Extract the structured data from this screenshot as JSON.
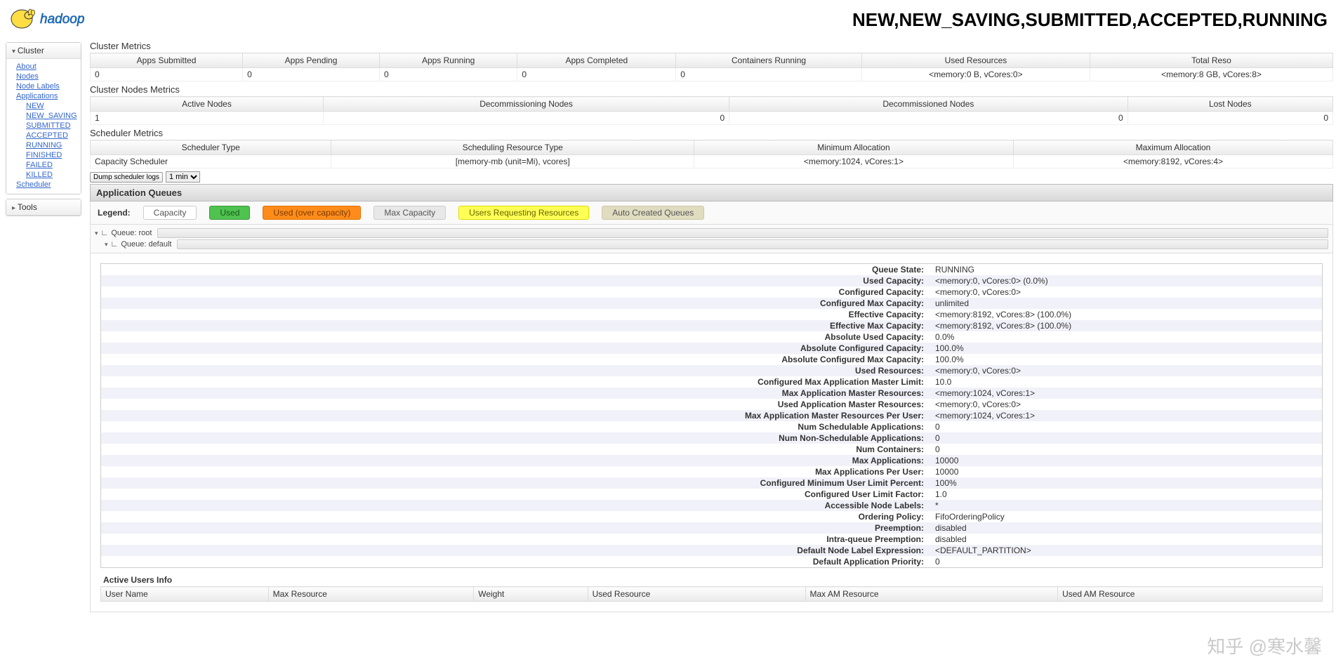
{
  "page_title": "NEW,NEW_SAVING,SUBMITTED,ACCEPTED,RUNNING",
  "sidebar": {
    "cluster": {
      "header": "Cluster",
      "links": {
        "about": "About",
        "nodes": "Nodes",
        "node_labels": "Node Labels",
        "applications": "Applications",
        "scheduler": "Scheduler"
      },
      "app_states": [
        "NEW",
        "NEW_SAVING",
        "SUBMITTED",
        "ACCEPTED",
        "RUNNING",
        "FINISHED",
        "FAILED",
        "KILLED"
      ]
    },
    "tools": {
      "header": "Tools"
    }
  },
  "cluster_metrics": {
    "title": "Cluster Metrics",
    "headers": [
      "Apps Submitted",
      "Apps Pending",
      "Apps Running",
      "Apps Completed",
      "Containers Running",
      "Used Resources",
      "Total Reso"
    ],
    "row": [
      "0",
      "0",
      "0",
      "0",
      "0",
      "<memory:0 B, vCores:0>",
      "<memory:8 GB, vCores:8>"
    ]
  },
  "nodes_metrics": {
    "title": "Cluster Nodes Metrics",
    "headers": [
      "Active Nodes",
      "Decommissioning Nodes",
      "Decommissioned Nodes",
      "Lost Nodes"
    ],
    "row": [
      "1",
      "0",
      "0",
      "0"
    ]
  },
  "scheduler_metrics": {
    "title": "Scheduler Metrics",
    "headers": [
      "Scheduler Type",
      "Scheduling Resource Type",
      "Minimum Allocation",
      "Maximum Allocation"
    ],
    "row": [
      "Capacity Scheduler",
      "[memory-mb (unit=Mi), vcores]",
      "<memory:1024, vCores:1>",
      "<memory:8192, vCores:4>"
    ]
  },
  "controls": {
    "dump_label": "Dump scheduler logs",
    "interval": "1 min"
  },
  "queues_panel": {
    "title": "Application Queues",
    "legend_label": "Legend:",
    "legend": {
      "capacity": "Capacity",
      "used": "Used",
      "used_over": "Used (over capacity)",
      "max": "Max Capacity",
      "requesting": "Users Requesting Resources",
      "auto": "Auto Created Queues"
    },
    "tree": {
      "root": "Queue: root",
      "default": "Queue: default"
    }
  },
  "queue_detail": [
    {
      "k": "Queue State:",
      "v": "RUNNING"
    },
    {
      "k": "Used Capacity:",
      "v": "<memory:0, vCores:0> (0.0%)"
    },
    {
      "k": "Configured Capacity:",
      "v": "<memory:0, vCores:0>"
    },
    {
      "k": "Configured Max Capacity:",
      "v": "unlimited"
    },
    {
      "k": "Effective Capacity:",
      "v": "<memory:8192, vCores:8> (100.0%)"
    },
    {
      "k": "Effective Max Capacity:",
      "v": "<memory:8192, vCores:8> (100.0%)"
    },
    {
      "k": "Absolute Used Capacity:",
      "v": "0.0%"
    },
    {
      "k": "Absolute Configured Capacity:",
      "v": "100.0%"
    },
    {
      "k": "Absolute Configured Max Capacity:",
      "v": "100.0%"
    },
    {
      "k": "Used Resources:",
      "v": "<memory:0, vCores:0>"
    },
    {
      "k": "Configured Max Application Master Limit:",
      "v": "10.0"
    },
    {
      "k": "Max Application Master Resources:",
      "v": "<memory:1024, vCores:1>"
    },
    {
      "k": "Used Application Master Resources:",
      "v": "<memory:0, vCores:0>"
    },
    {
      "k": "Max Application Master Resources Per User:",
      "v": "<memory:1024, vCores:1>"
    },
    {
      "k": "Num Schedulable Applications:",
      "v": "0"
    },
    {
      "k": "Num Non-Schedulable Applications:",
      "v": "0"
    },
    {
      "k": "Num Containers:",
      "v": "0"
    },
    {
      "k": "Max Applications:",
      "v": "10000"
    },
    {
      "k": "Max Applications Per User:",
      "v": "10000"
    },
    {
      "k": "Configured Minimum User Limit Percent:",
      "v": "100%"
    },
    {
      "k": "Configured User Limit Factor:",
      "v": "1.0"
    },
    {
      "k": "Accessible Node Labels:",
      "v": "*"
    },
    {
      "k": "Ordering Policy:",
      "v": "FifoOrderingPolicy"
    },
    {
      "k": "Preemption:",
      "v": "disabled"
    },
    {
      "k": "Intra-queue Preemption:",
      "v": "disabled"
    },
    {
      "k": "Default Node Label Expression:",
      "v": "<DEFAULT_PARTITION>"
    },
    {
      "k": "Default Application Priority:",
      "v": "0"
    }
  ],
  "active_users": {
    "title": "Active Users Info",
    "headers": [
      "User Name",
      "Max Resource",
      "Weight",
      "Used Resource",
      "Max AM Resource",
      "Used AM Resource"
    ]
  },
  "watermark": "知乎 @寒水馨"
}
